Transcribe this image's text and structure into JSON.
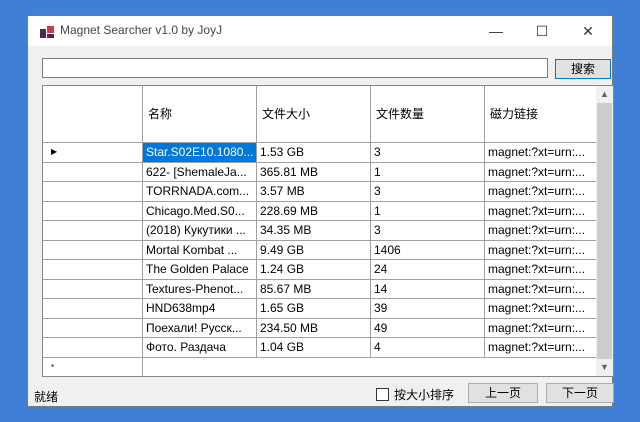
{
  "window": {
    "title": "Magnet Searcher v1.0 by JoyJ",
    "minimize_glyph": "—",
    "maximize_glyph": "☐",
    "close_glyph": "✕"
  },
  "search": {
    "value": "",
    "button_label": "搜索"
  },
  "table": {
    "columns": [
      "名称",
      "文件大小",
      "文件数量",
      "磁力链接"
    ],
    "rows": [
      [
        "Star.S02E10.1080...",
        "1.53 GB",
        "3",
        "magnet:?xt=urn:..."
      ],
      [
        "622- [ShemaleJa...",
        "365.81 MB",
        "1",
        "magnet:?xt=urn:..."
      ],
      [
        "TORRNADA.com...",
        "3.57 MB",
        "3",
        "magnet:?xt=urn:..."
      ],
      [
        "Chicago.Med.S0...",
        "228.69 MB",
        "1",
        "magnet:?xt=urn:..."
      ],
      [
        "(2018) Кукутики ...",
        "34.35 MB",
        "3",
        "magnet:?xt=urn:..."
      ],
      [
        "Mortal Kombat ...",
        "9.49 GB",
        "1406",
        "magnet:?xt=urn:..."
      ],
      [
        "The Golden Palace",
        "1.24 GB",
        "24",
        "magnet:?xt=urn:..."
      ],
      [
        "Textures-Phenot...",
        "85.67 MB",
        "14",
        "magnet:?xt=urn:..."
      ],
      [
        "HND638mp4",
        "1.65 GB",
        "39",
        "magnet:?xt=urn:..."
      ],
      [
        "Поехали! Русск...",
        "234.50 MB",
        "49",
        "magnet:?xt=urn:..."
      ],
      [
        "Фото. Раздача",
        "1.04 GB",
        "4",
        "magnet:?xt=urn:..."
      ]
    ],
    "current_row_marker": "▶",
    "new_row_marker": "*"
  },
  "status": {
    "text": "就绪",
    "sort_label": "按大小排序",
    "sort_checked": false,
    "prev_label": "上一页",
    "next_label": "下一页"
  },
  "colors": {
    "desktop": "#3f7fd6",
    "selection": "#0078d7",
    "app_icon_dark": "#4b2a5a",
    "app_icon_accent": "#c83a50"
  }
}
